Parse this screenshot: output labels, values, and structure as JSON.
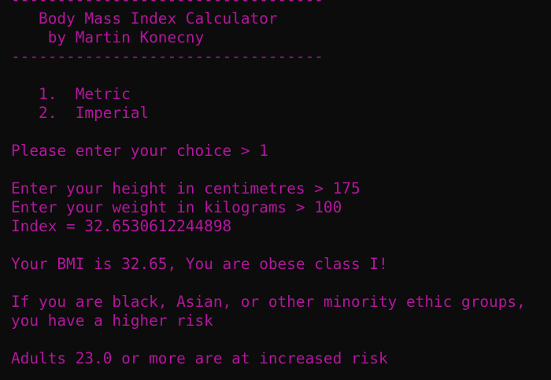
{
  "terminal": {
    "text_color": "#b4169e",
    "background_color": "#0c0c0c",
    "lines": [
      "----------------------------------",
      "   Body Mass Index Calculator",
      "    by Martin Konecny",
      "----------------------------------",
      "",
      "   1.  Metric",
      "   2.  Imperial",
      "",
      "Please enter your choice > 1",
      "",
      "Enter your height in centimetres > 175",
      "Enter your weight in kilograms > 100",
      "Index = 32.6530612244898",
      "",
      "Your BMI is 32.65, You are obese class I!",
      "",
      "If you are black, Asian, or other minority ethic groups,",
      "you have a higher risk",
      "",
      "Adults 23.0 or more are at increased risk"
    ]
  }
}
